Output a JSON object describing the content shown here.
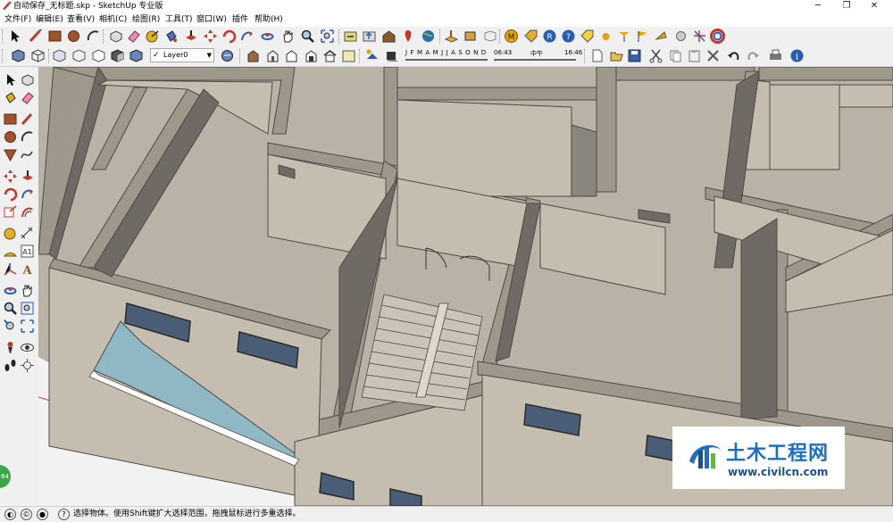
{
  "window": {
    "title": "自动保存_无标题.skp - SketchUp 专业版",
    "controls": [
      "minimize-icon",
      "maximize-icon",
      "close-icon"
    ]
  },
  "menubar": {
    "items": [
      "文件(F)",
      "编辑(E)",
      "查看(V)",
      "相机(C)",
      "绘图(R)",
      "工具(T)",
      "窗口(W)",
      "插件",
      "帮助(H)"
    ]
  },
  "layers": {
    "current": "Layer0"
  },
  "shadow": {
    "months": "J F M A M J J A S O N D",
    "time_start": "06:43",
    "time_mid": "中午",
    "time_end": "16:46"
  },
  "status": {
    "text": "选择物体。使用Shift键扩大选择范围，拖拽鼠标进行多重选择。"
  },
  "badge": {
    "label": "64"
  },
  "watermark": {
    "title": "土木工程网",
    "url": "www.civilcn.com"
  },
  "colors": {
    "wall_top": "#9d978c",
    "wall_light": "#c4bdb0",
    "wall_dark": "#6f6a63",
    "floor": "#bab3a7",
    "window_blue": "#4a5d76",
    "brand_blue": "#1c6fc0"
  }
}
